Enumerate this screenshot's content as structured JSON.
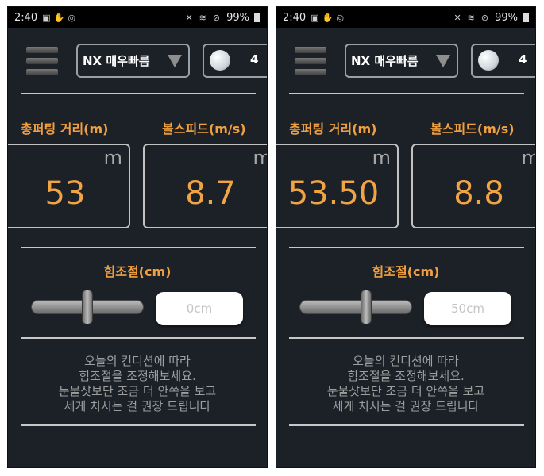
{
  "screens": [
    {
      "status": {
        "time": "2:40",
        "battery": "99%"
      },
      "mode": "NX 매우빠름",
      "ball_number": "4",
      "distance": {
        "label": "총퍼팅 거리(m)",
        "unit": "m",
        "value": "53"
      },
      "speed": {
        "label": "볼스피드(m/s)",
        "unit": "m/",
        "value": "8.7"
      },
      "adjust": {
        "label": "힘조절(cm)",
        "value": "0cm",
        "slider_level": 0.5
      },
      "advice": [
        "오늘의 컨디션에 따라",
        "힘조절을 조정해보세요.",
        "눈물샷보단 조금 더 안쪽을 보고",
        "세게 치시는 걸 권장 드립니다"
      ]
    },
    {
      "status": {
        "time": "2:40",
        "battery": "99%"
      },
      "mode": "NX 매우빠름",
      "ball_number": "4",
      "distance": {
        "label": "총퍼팅 거리(m)",
        "unit": "m",
        "value": "53.50"
      },
      "speed": {
        "label": "볼스피드(m/s)",
        "unit": "m/",
        "value": "8.8"
      },
      "adjust": {
        "label": "힘조절(cm)",
        "value": "50cm",
        "slider_level": 0.59
      },
      "advice": [
        "오늘의 컨디션에 따라",
        "힘조절을 조정해보세요.",
        "눈물샷보단 조금 더 안쪽을 보고",
        "세게 치시는 걸 권장 드립니다"
      ]
    }
  ]
}
